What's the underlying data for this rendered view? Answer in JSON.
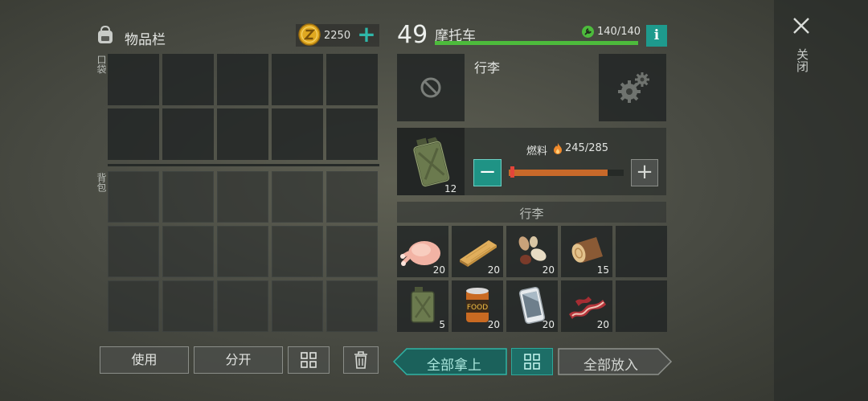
{
  "inventory": {
    "title": "物品栏",
    "coins": "2250",
    "plus": "+",
    "pocket_label": "口袋",
    "backpack_label": "背包",
    "icons": {
      "header": "backpack-icon",
      "coin": "coin-icon"
    }
  },
  "actions": {
    "use": "使用",
    "split": "分开",
    "sort_icon": "sort-grid-icon",
    "trash_icon": "trash-icon"
  },
  "vehicle": {
    "level": "49",
    "name": "摩托车",
    "durability": "140/140",
    "durability_fraction": 1.0,
    "info": "i",
    "storage_label": "行李"
  },
  "fuel": {
    "label": "燃料",
    "value": "245/285",
    "fill_fraction": 0.86,
    "canister_count": "12",
    "minus": "−",
    "plus": "+"
  },
  "storage": {
    "header": "行李",
    "items": [
      {
        "name": "raw-chicken-icon",
        "qty": "20"
      },
      {
        "name": "wood-plank-icon",
        "qty": "20"
      },
      {
        "name": "nuts-seeds-icon",
        "qty": "20"
      },
      {
        "name": "log-icon",
        "qty": "15"
      },
      {
        "name": "",
        "qty": ""
      },
      {
        "name": "jerry-can-icon",
        "qty": "5"
      },
      {
        "name": "canned-food-icon",
        "qty": "20"
      },
      {
        "name": "smartphone-icon",
        "qty": "20"
      },
      {
        "name": "bacon-icon",
        "qty": "20"
      },
      {
        "name": "",
        "qty": ""
      }
    ]
  },
  "transfer": {
    "take_all": "全部拿上",
    "put_all": "全部放入"
  },
  "close": {
    "label": "关闭"
  },
  "colors": {
    "accent": "#1f9385",
    "durability": "#4dbb3c",
    "fuel": "#c8692a",
    "coin": "#e0a820"
  }
}
